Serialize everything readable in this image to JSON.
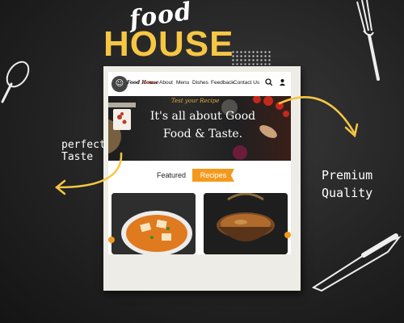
{
  "logo": {
    "word1": "food",
    "word2": "HOUSE"
  },
  "nav": {
    "brand": "Food House",
    "links": [
      "Home",
      "About",
      "Menu",
      "Dishes",
      "Feedback",
      "Contact Us"
    ],
    "search_icon": "search-icon",
    "user_icon": "user-icon"
  },
  "hero": {
    "small_text": "Test your Recipe",
    "title_line1": "It's all about Good",
    "title_line2": "Food & Taste."
  },
  "section": {
    "label": "Featured",
    "badge": "Recipes"
  },
  "annotations": {
    "left_line1": "perfect",
    "left_line2": "Taste",
    "right_line1": "Premium",
    "right_line2": "Quality"
  },
  "colors": {
    "accent": "#f39a1d",
    "logo_yellow": "#f6c744",
    "active_link": "#c0392b"
  }
}
